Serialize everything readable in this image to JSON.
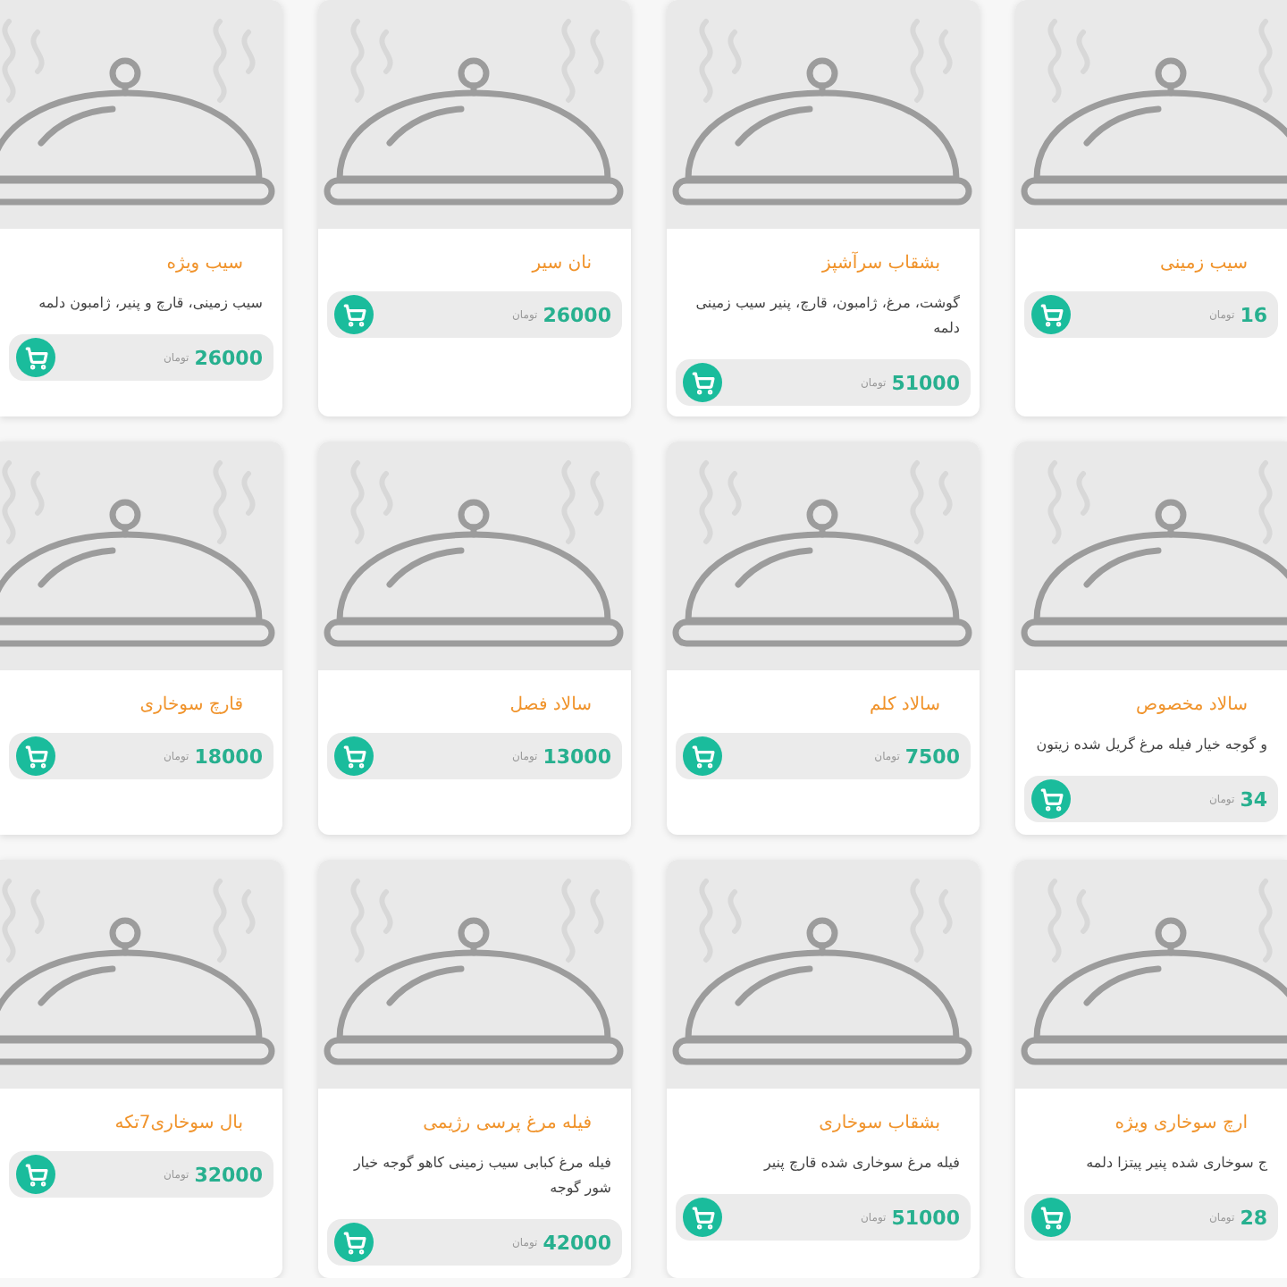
{
  "products": [
    {
      "name": "سیب زمینی",
      "price": "16",
      "currency": "تومان"
    },
    {
      "name": "بشقاب سرآشپز",
      "description": "گوشت، مرغ، ژامبون، قارچ، پنیر سیب زمینی دلمه",
      "price": "51000",
      "currency": "تومان"
    },
    {
      "name": "نان سیر",
      "price": "26000",
      "currency": "تومان"
    },
    {
      "name": "سیب ویژه",
      "description": "سیب زمینی، قارچ و پنیر، ژامبون دلمه",
      "price": "26000",
      "currency": "تومان"
    },
    {
      "name": "سالاد مخصوص",
      "description": "و گوجه خیار فیله مرغ گریل شده زیتون",
      "price": "34",
      "currency": "تومان"
    },
    {
      "name": "سالاد کلم",
      "price": "7500",
      "currency": "تومان"
    },
    {
      "name": "سالاد فصل",
      "price": "13000",
      "currency": "تومان"
    },
    {
      "name": "قارچ سوخاری",
      "price": "18000",
      "currency": "تومان"
    },
    {
      "name": "ارچ سوخاری ویژه",
      "description": "ج سوخاری شده پنیر پیتزا دلمه",
      "price": "28",
      "currency": "تومان"
    },
    {
      "name": "بشقاب سوخاری",
      "description": "فیله مرغ سوخاری شده قارچ پنیر",
      "price": "51000",
      "currency": "تومان"
    },
    {
      "name": "فیله مرغ پرسی رژیمی",
      "description": "فیله مرغ کبابی سیب زمینی کاهو گوجه خیار شور گوجه",
      "price": "42000",
      "currency": "تومان"
    },
    {
      "name": "بال سوخاری7تکه",
      "price": "32000",
      "currency": "تومان"
    }
  ]
}
